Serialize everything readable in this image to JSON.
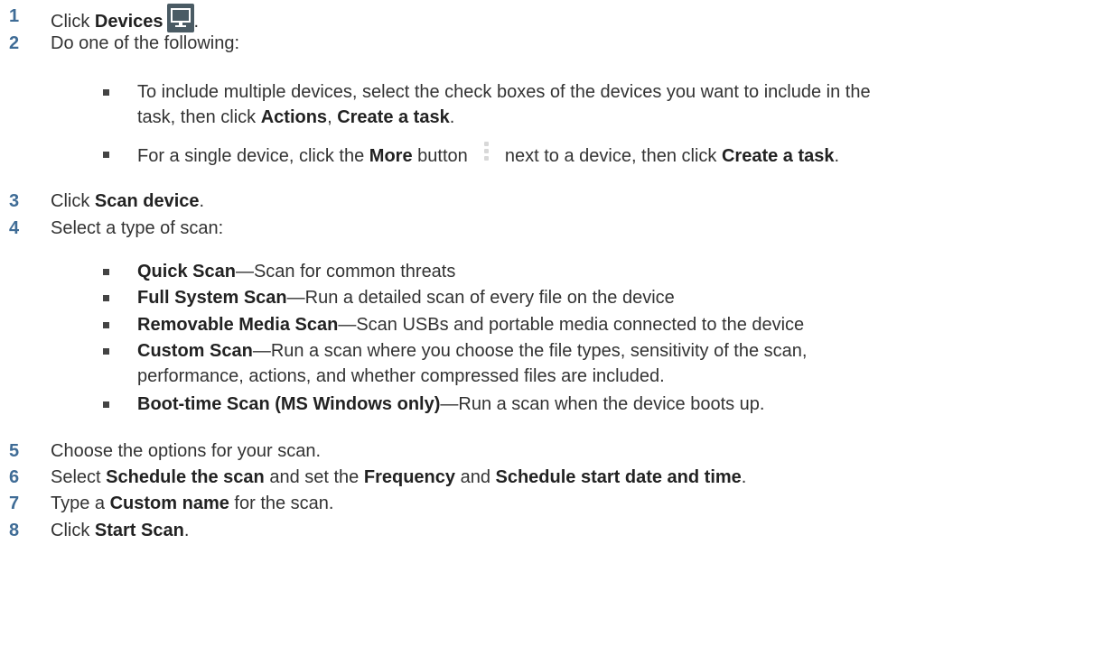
{
  "steps": [
    {
      "num": "1",
      "pre": "Click ",
      "b1": "Devices",
      "post": "."
    },
    {
      "num": "2",
      "text": "Do one of the following:"
    },
    {
      "num": "3",
      "pre": "Click ",
      "b1": "Scan device",
      "post": "."
    },
    {
      "num": "4",
      "text": "Select a type of scan:"
    },
    {
      "num": "5",
      "text": "Choose the options for your scan."
    },
    {
      "num": "6",
      "pre": "Select ",
      "b1": "Schedule the scan",
      "mid1": " and set the ",
      "b2": "Frequency",
      "mid2": " and ",
      "b3": "Schedule start date and time",
      "post": "."
    },
    {
      "num": "7",
      "pre": "Type a ",
      "b1": "Custom name",
      "post": " for the scan."
    },
    {
      "num": "8",
      "pre": "Click ",
      "b1": "Start Scan",
      "post": "."
    }
  ],
  "step2_bullets": [
    {
      "line1": "To include multiple devices, select the check boxes of the devices you want to include in the",
      "line2_pre": "task, then click ",
      "b1": "Actions",
      "sep": ", ",
      "b2": "Create a task",
      "post": "."
    },
    {
      "pre": "For a single device, click the ",
      "b1": "More",
      "mid": " button ",
      "mid2": " next to a device, then click ",
      "b2": "Create a task",
      "post": "."
    }
  ],
  "scan_types": [
    {
      "name": "Quick Scan",
      "desc": "—Scan for common threats"
    },
    {
      "name": "Full System Scan",
      "desc": "—Run a detailed scan of every file on the device"
    },
    {
      "name": "Removable Media Scan",
      "desc": "—Scan USBs and portable media connected to the device"
    },
    {
      "name": "Custom Scan",
      "desc": "—Run a scan where you choose the file types, sensitivity of the scan,",
      "desc2": "performance, actions, and whether compressed files are included."
    },
    {
      "name": "Boot-time Scan (MS Windows only)",
      "desc": "—Run a scan when the device boots up."
    }
  ],
  "icons": {
    "devices": "monitor-icon",
    "more": "more-vertical-icon"
  },
  "colors": {
    "step_number": "#3f6c96",
    "text": "#333333"
  }
}
